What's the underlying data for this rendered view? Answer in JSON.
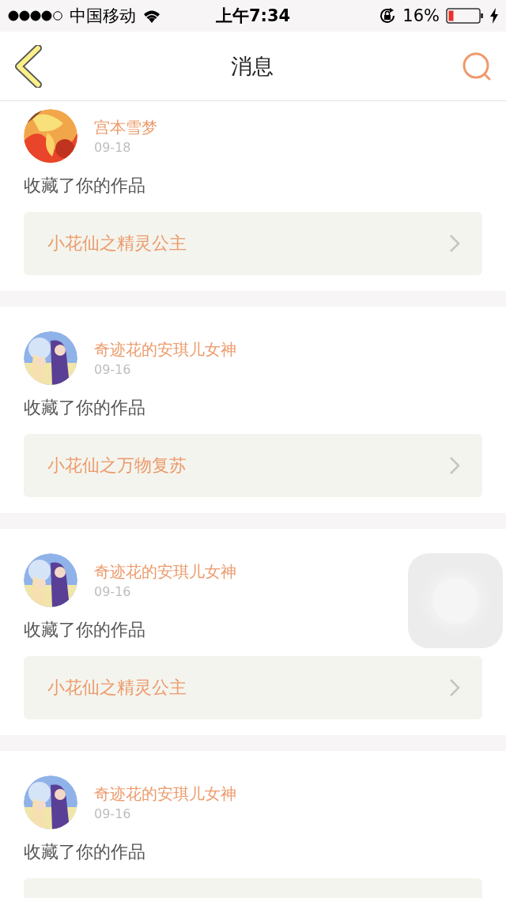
{
  "status_bar": {
    "carrier": "中国移动",
    "time": "上午7:34",
    "battery": "16%"
  },
  "header": {
    "title": "消息"
  },
  "messages": [
    {
      "user": "宫本雪梦",
      "date": "09-18",
      "action": "收藏了你的作品",
      "work": "小花仙之精灵公主"
    },
    {
      "user": "奇迹花的安琪儿女神",
      "date": "09-16",
      "action": "收藏了你的作品",
      "work": "小花仙之万物复苏"
    },
    {
      "user": "奇迹花的安琪儿女神",
      "date": "09-16",
      "action": "收藏了你的作品",
      "work": "小花仙之精灵公主"
    },
    {
      "user": "奇迹花的安琪儿女神",
      "date": "09-16",
      "action": "收藏了你的作品"
    }
  ]
}
